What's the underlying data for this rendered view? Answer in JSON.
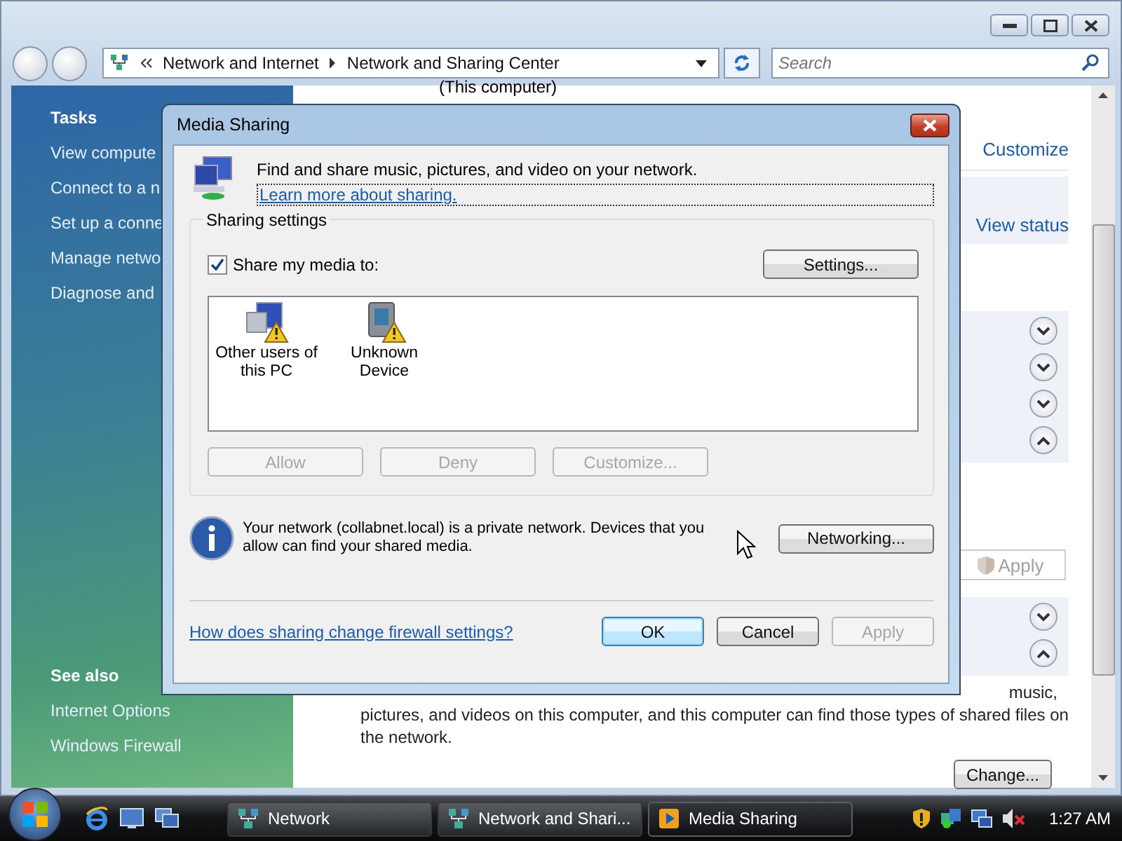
{
  "explorer": {
    "path": [
      {
        "label": "Network and Internet"
      },
      {
        "label": "Network and Sharing Center"
      }
    ],
    "search": {
      "placeholder": "Search"
    }
  },
  "tasks_pane": {
    "heading": "Tasks",
    "items": [
      "View compute",
      "Connect to a n",
      "Set up a conne",
      "Manage netwo",
      "Diagnose and"
    ],
    "see_also_heading": "See also",
    "see_also": [
      "Internet Options",
      "Windows Firewall"
    ]
  },
  "content": {
    "caption": "(This computer)",
    "customize_link": "Customize",
    "view_status_link": "View status",
    "toggles": [
      {
        "expanded": false
      },
      {
        "expanded": false
      },
      {
        "expanded": false
      },
      {
        "expanded": true
      }
    ],
    "apply_button": {
      "label": "Apply",
      "disabled": true
    },
    "more_toggles": [
      {
        "expanded": false
      },
      {
        "expanded": true
      }
    ],
    "description_tail": "music,",
    "description": "pictures, and videos on this computer, and this computer can find those types of shared files on the network.",
    "change_button": "Change..."
  },
  "dialog": {
    "title": "Media Sharing",
    "intro": "Find and share music, pictures, and video on your network.",
    "learn_link": "Learn more about sharing.",
    "group_label": "Sharing settings",
    "share_checkbox": {
      "label": "Share my media to:",
      "checked": true
    },
    "settings_button": "Settings...",
    "devices": [
      {
        "label": "Other users of this PC",
        "kind": "computer"
      },
      {
        "label": "Unknown Device",
        "kind": "device"
      }
    ],
    "device_buttons": [
      {
        "label": "Allow",
        "disabled": true
      },
      {
        "label": "Deny",
        "disabled": true
      },
      {
        "label": "Customize...",
        "disabled": true
      }
    ],
    "network_note": "Your network (collabnet.local) is a private network. Devices that you allow can find your shared media.",
    "networking_button": "Networking...",
    "firewall_link": "How does sharing change firewall settings?",
    "buttons": [
      {
        "label": "OK",
        "default": true,
        "disabled": false
      },
      {
        "label": "Cancel",
        "default": false,
        "disabled": false
      },
      {
        "label": "Apply",
        "default": false,
        "disabled": true
      }
    ]
  },
  "taskbar": {
    "tasks": [
      {
        "label": "Network",
        "selected": false
      },
      {
        "label": "Network and Shari...",
        "selected": false
      },
      {
        "label": "Media Sharing",
        "selected": true
      }
    ],
    "clock": "1:27 AM"
  }
}
